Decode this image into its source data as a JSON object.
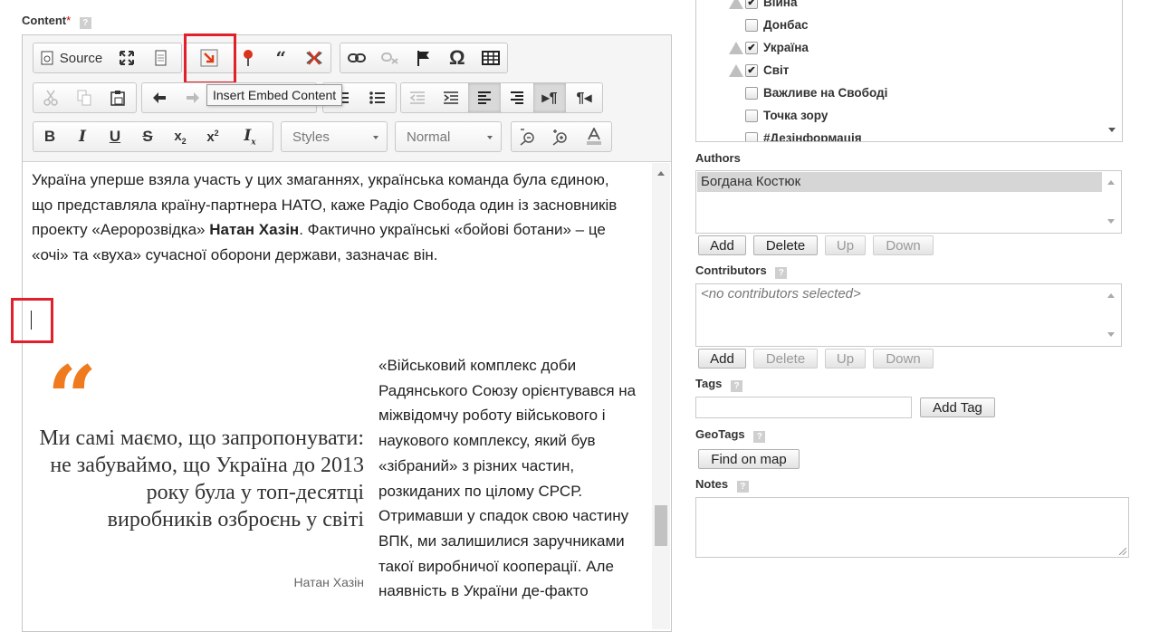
{
  "content": {
    "label": "Content",
    "required_mark": "*"
  },
  "toolbar": {
    "source_label": "Source",
    "styles_label": "Styles",
    "format_label": "Normal",
    "tooltip": "Insert Embed Content"
  },
  "editor": {
    "intro_pre": "Україна уперше взяла участь у цих змаганнях, українська команда була єдиною, що представляла країну-партнера НАТО, каже Радіо Свобода один із засновників проекту «Аеророзвідка» ",
    "intro_name": "Натан Хазін",
    "intro_post": ". Фактично українські «бойові ботани» – це «очі» та «вуха» сучасної оборони держави, зазначає він.",
    "quote_mark": "“",
    "quote_text": "Ми самі маємо, що запропонувати: не забуваймо, що Україна до 2013 року була у топ-десятці виробників озброєнь у світі",
    "quote_author": "Натан Хазін",
    "side_text": "«Військовий комплекс доби Радянського Союзу орієнтувався на міжвідомчу роботу військового і наукового комплексу, який був «зібраний» з різних частин, розкиданих по цілому СРСР. Отримавши у спадок свою частину ВПК, ми залишилися заручниками такої виробничої кооперації. Але наявність в України де-факто"
  },
  "categories": [
    {
      "label": "Війна",
      "checked": true,
      "warn": true
    },
    {
      "label": "Донбас",
      "checked": false,
      "warn": false
    },
    {
      "label": "Україна",
      "checked": true,
      "warn": true
    },
    {
      "label": "Світ",
      "checked": true,
      "warn": true
    },
    {
      "label": "Важливе на Свободі",
      "checked": false,
      "warn": false
    },
    {
      "label": "Точка зору",
      "checked": false,
      "warn": false
    },
    {
      "label": "#Дезінформація",
      "checked": false,
      "warn": false
    }
  ],
  "authors": {
    "label": "Authors",
    "items": [
      "Богдана Костюк"
    ],
    "buttons": {
      "add": "Add",
      "delete": "Delete",
      "up": "Up",
      "down": "Down"
    }
  },
  "contributors": {
    "label": "Contributors",
    "placeholder": "<no contributors selected>",
    "buttons": {
      "add": "Add",
      "delete": "Delete",
      "up": "Up",
      "down": "Down"
    }
  },
  "tags": {
    "label": "Tags",
    "add_button": "Add Tag"
  },
  "geotags": {
    "label": "GeoTags",
    "find_button": "Find on map"
  },
  "notes": {
    "label": "Notes"
  },
  "icons": {
    "help": "?",
    "check": "✔"
  },
  "colors": {
    "accent_red": "#e0202a",
    "quote_orange": "#f07a1e"
  }
}
